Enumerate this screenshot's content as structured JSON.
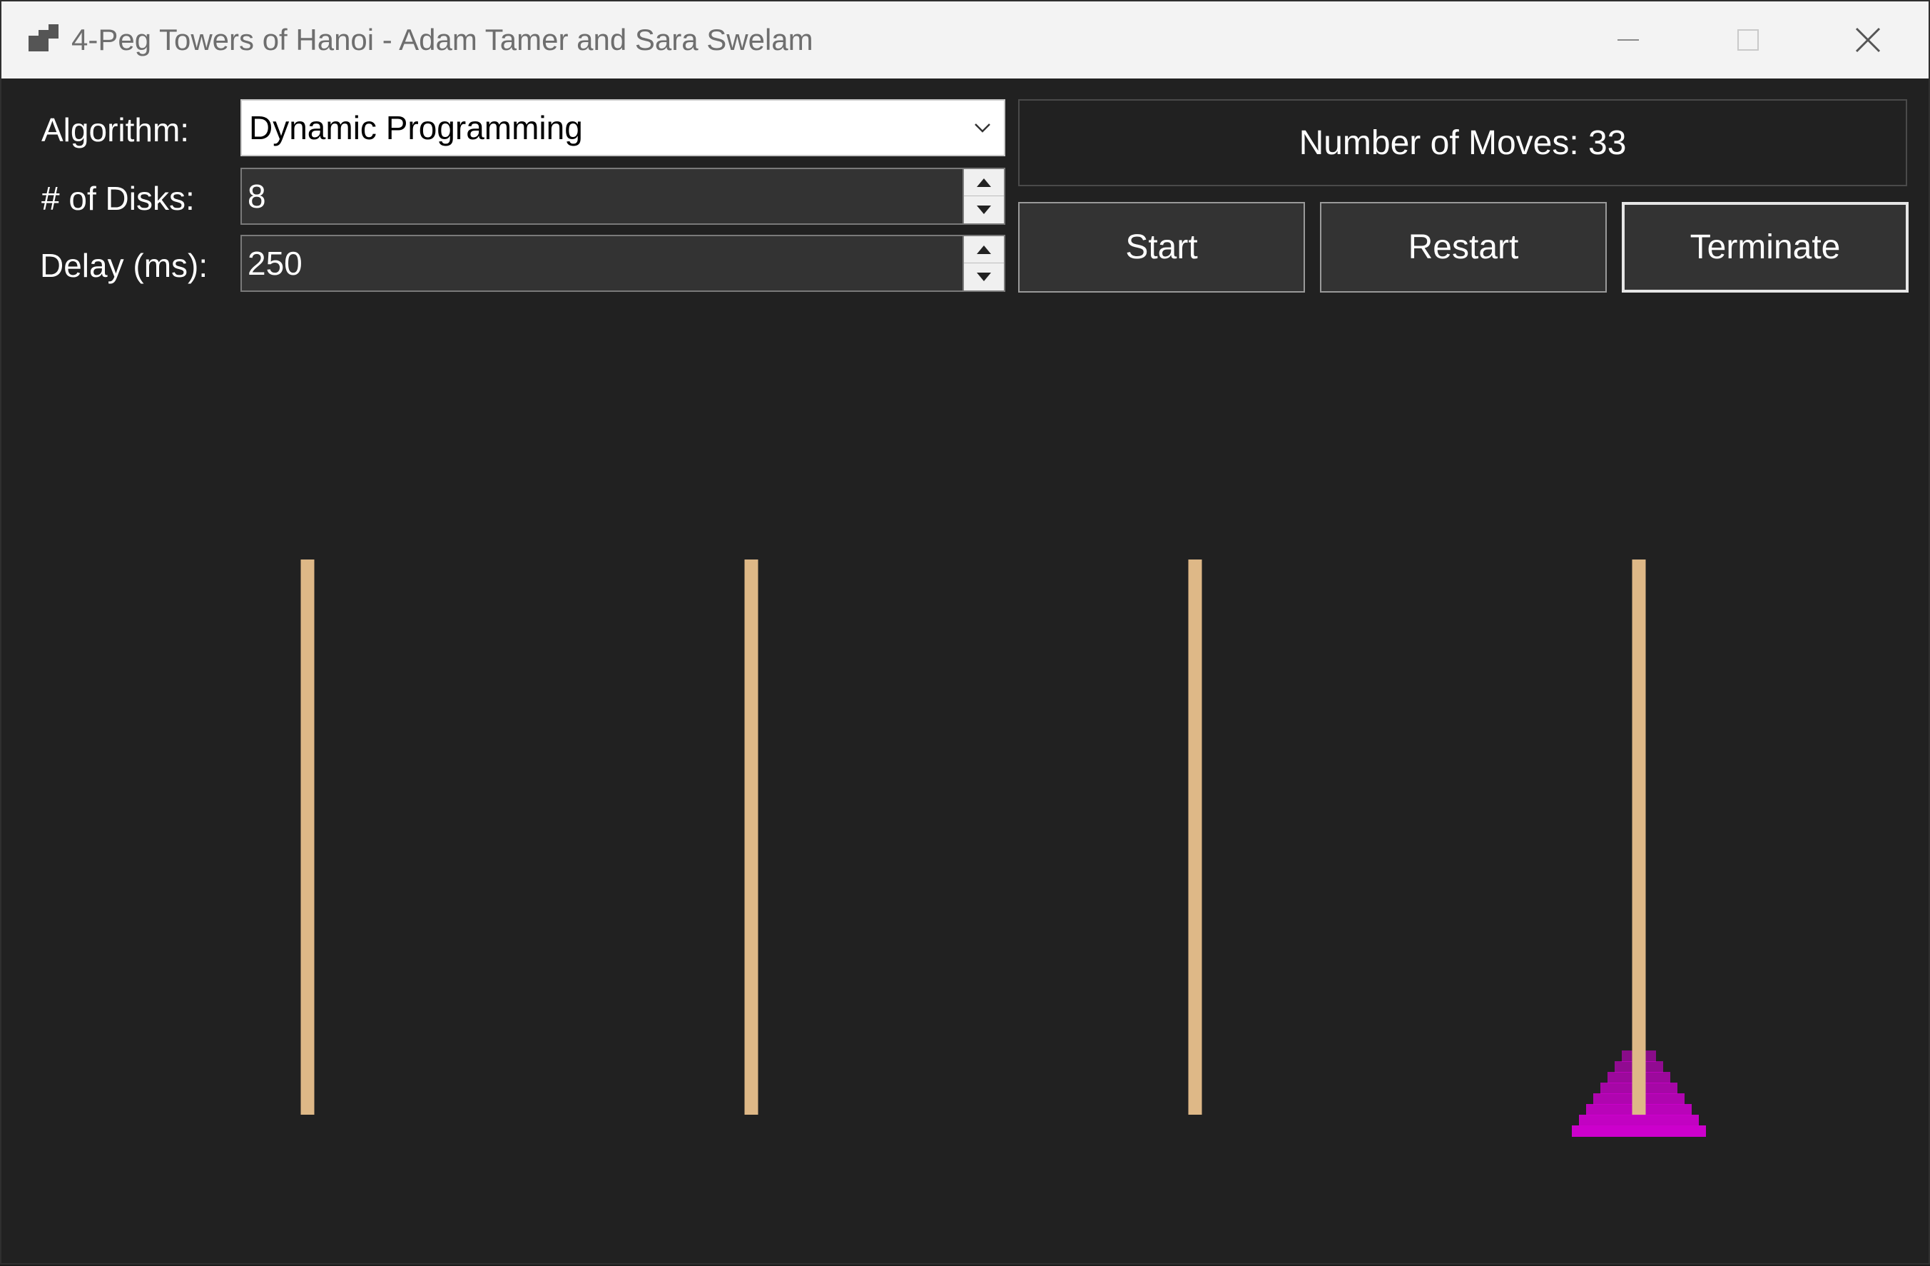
{
  "window": {
    "title": "4-Peg Towers of Hanoi - Adam Tamer and Sara Swelam"
  },
  "controls": {
    "algorithm_label": "Algorithm:",
    "algorithm_value": "Dynamic Programming",
    "disks_label": "# of Disks:",
    "disks_value": "8",
    "delay_label": "Delay (ms):",
    "delay_value": "250"
  },
  "status": {
    "moves_text": "Number of Moves: 33"
  },
  "buttons": {
    "start": "Start",
    "restart": "Restart",
    "terminate": "Terminate"
  },
  "board": {
    "peg_count": 4,
    "peg_color": "#deb887",
    "disk_color": "#cc00cc",
    "disks_per_peg": [
      0,
      0,
      0,
      8
    ]
  }
}
